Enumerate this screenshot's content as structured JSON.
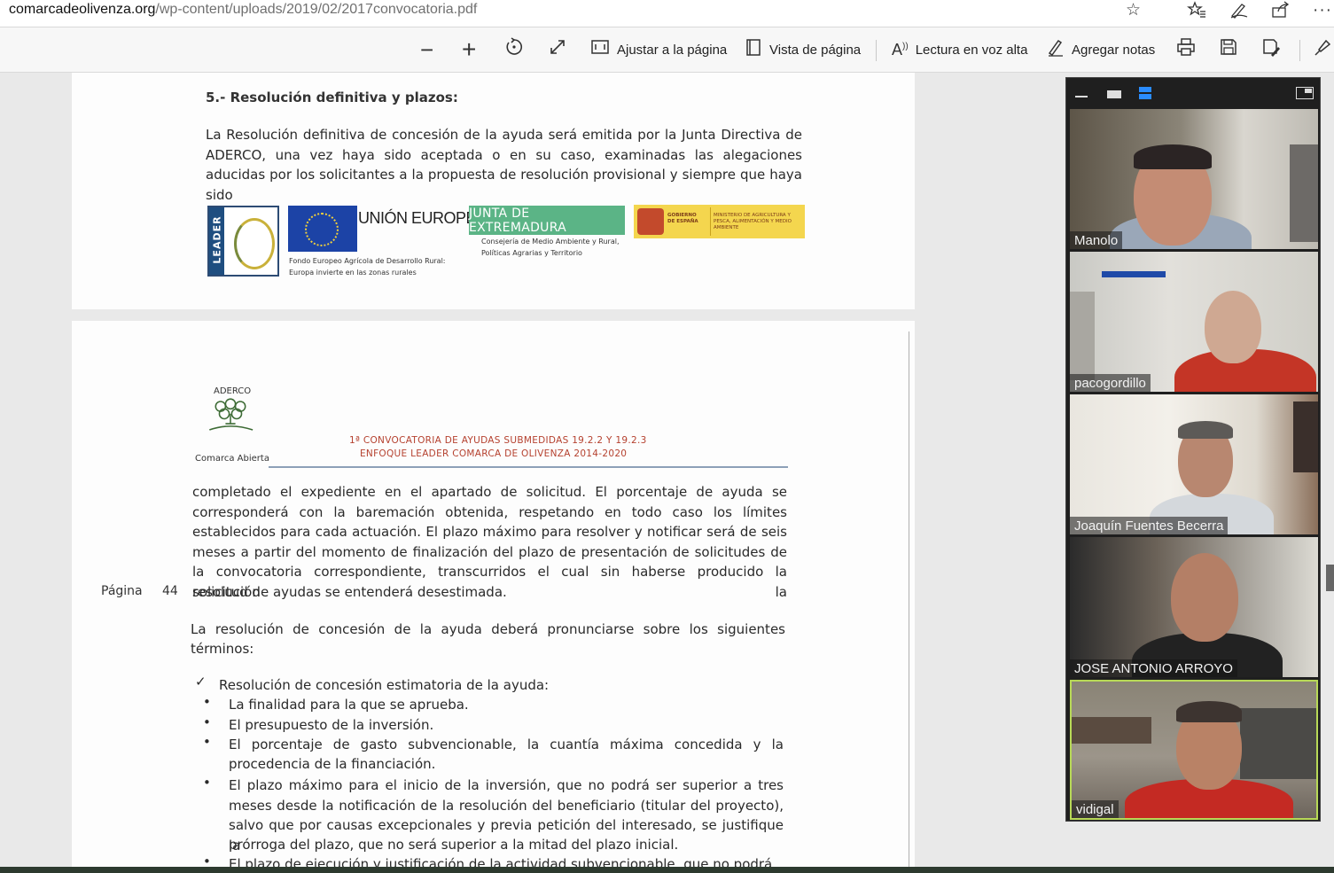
{
  "browser": {
    "url_host": "comarcadeolivenza.org",
    "url_path": "/wp-content/uploads/2019/02/2017convocatoria.pdf",
    "icons": [
      "star-icon",
      "favorites-icon",
      "pen-icon",
      "share-icon",
      "more-icon"
    ]
  },
  "toolbar": {
    "zoom_out_icon": "−",
    "zoom_in_icon": "+",
    "fit_page_label": "Ajustar a la página",
    "page_view_label": "Vista de página",
    "read_aloud_label": "Lectura en voz alta",
    "add_notes_label": "Agregar notas"
  },
  "pdf": {
    "page1": {
      "section_heading": "5.- Resolución definitiva y plazos:",
      "paragraph": "La Resolución definitiva de concesión de la ayuda será emitida por la Junta Directiva de ADERCO, una vez haya sido aceptada o en su caso, examinadas las alegaciones aducidas por los solicitantes a la propuesta de resolución provisional y siempre que haya sido",
      "logos": {
        "leader": "LEADER",
        "eu_title": "UNIÓN EUROPEA",
        "eu_sub_1": "Fondo Europeo Agrícola de Desarrollo Rural:",
        "eu_sub_2": "Europa invierte en las zonas rurales",
        "jex_title": "JUNTA DE EXTREMADURA",
        "jex_sub_1": "Consejería de Medio Ambiente y Rural,",
        "jex_sub_2": "Políticas Agrarias y Territorio",
        "spain_1": "GOBIERNO DE ESPAÑA",
        "spain_2": "MINISTERIO DE AGRICULTURA Y PESCA, ALIMENTACIÓN Y MEDIO AMBIENTE"
      }
    },
    "page2": {
      "aderco_label": "ADERCO",
      "aderco_sub": "Comarca Abierta",
      "header_line1": "1ª CONVOCATORIA DE AYUDAS SUBMEDIDAS 19.2.2 Y 19.2.3",
      "header_line2": "ENFOQUE LEADER COMARCA DE OLIVENZA 2014-2020",
      "page_label": "Página",
      "page_number": "44",
      "para1": "completado el expediente en el apartado de solicitud. El porcentaje de ayuda se corresponderá con la baremación obtenida, respetando en todo caso los límites establecidos para cada actuación. El plazo máximo para resolver y notificar será de seis meses a partir del momento de finalización del plazo de presentación de solicitudes de la convocatoria correspondiente, transcurridos el cual sin haberse producido la resolución la",
      "para1_last": "solicitud de ayudas se entenderá desestimada.",
      "para2": "La resolución de concesión de la ayuda deberá pronunciarse sobre los siguientes",
      "para2_last": "términos:",
      "check_item": "Resolución de concesión estimatoria de la ayuda:",
      "bullet1": "La finalidad para la que se aprueba.",
      "bullet2": "El presupuesto de la inversión.",
      "bullet3a": "El porcentaje de gasto subvencionable, la cuantía máxima concedida y la",
      "bullet3b": "procedencia de la financiación.",
      "bullet4a": "El plazo máximo para el inicio de la inversión, que no podrá ser superior a tres meses desde la notificación de la resolución del beneficiario (titular del proyecto), salvo que por causas excepcionales y previa petición del interesado, se justifique la",
      "bullet4b": "prórroga del plazo, que no será superior a la mitad del plazo inicial.",
      "bullet5": "El plazo de ejecución y justificación de la actividad subvencionable, que no podrá"
    }
  },
  "video": {
    "participants": [
      {
        "name": "Manolo"
      },
      {
        "name": "pacogordillo"
      },
      {
        "name": "Joaquín Fuentes Becerra"
      },
      {
        "name": "JOSE ANTONIO ARROYO"
      },
      {
        "name": "vidigal"
      }
    ],
    "active_speaker_color": "#b8d957"
  }
}
